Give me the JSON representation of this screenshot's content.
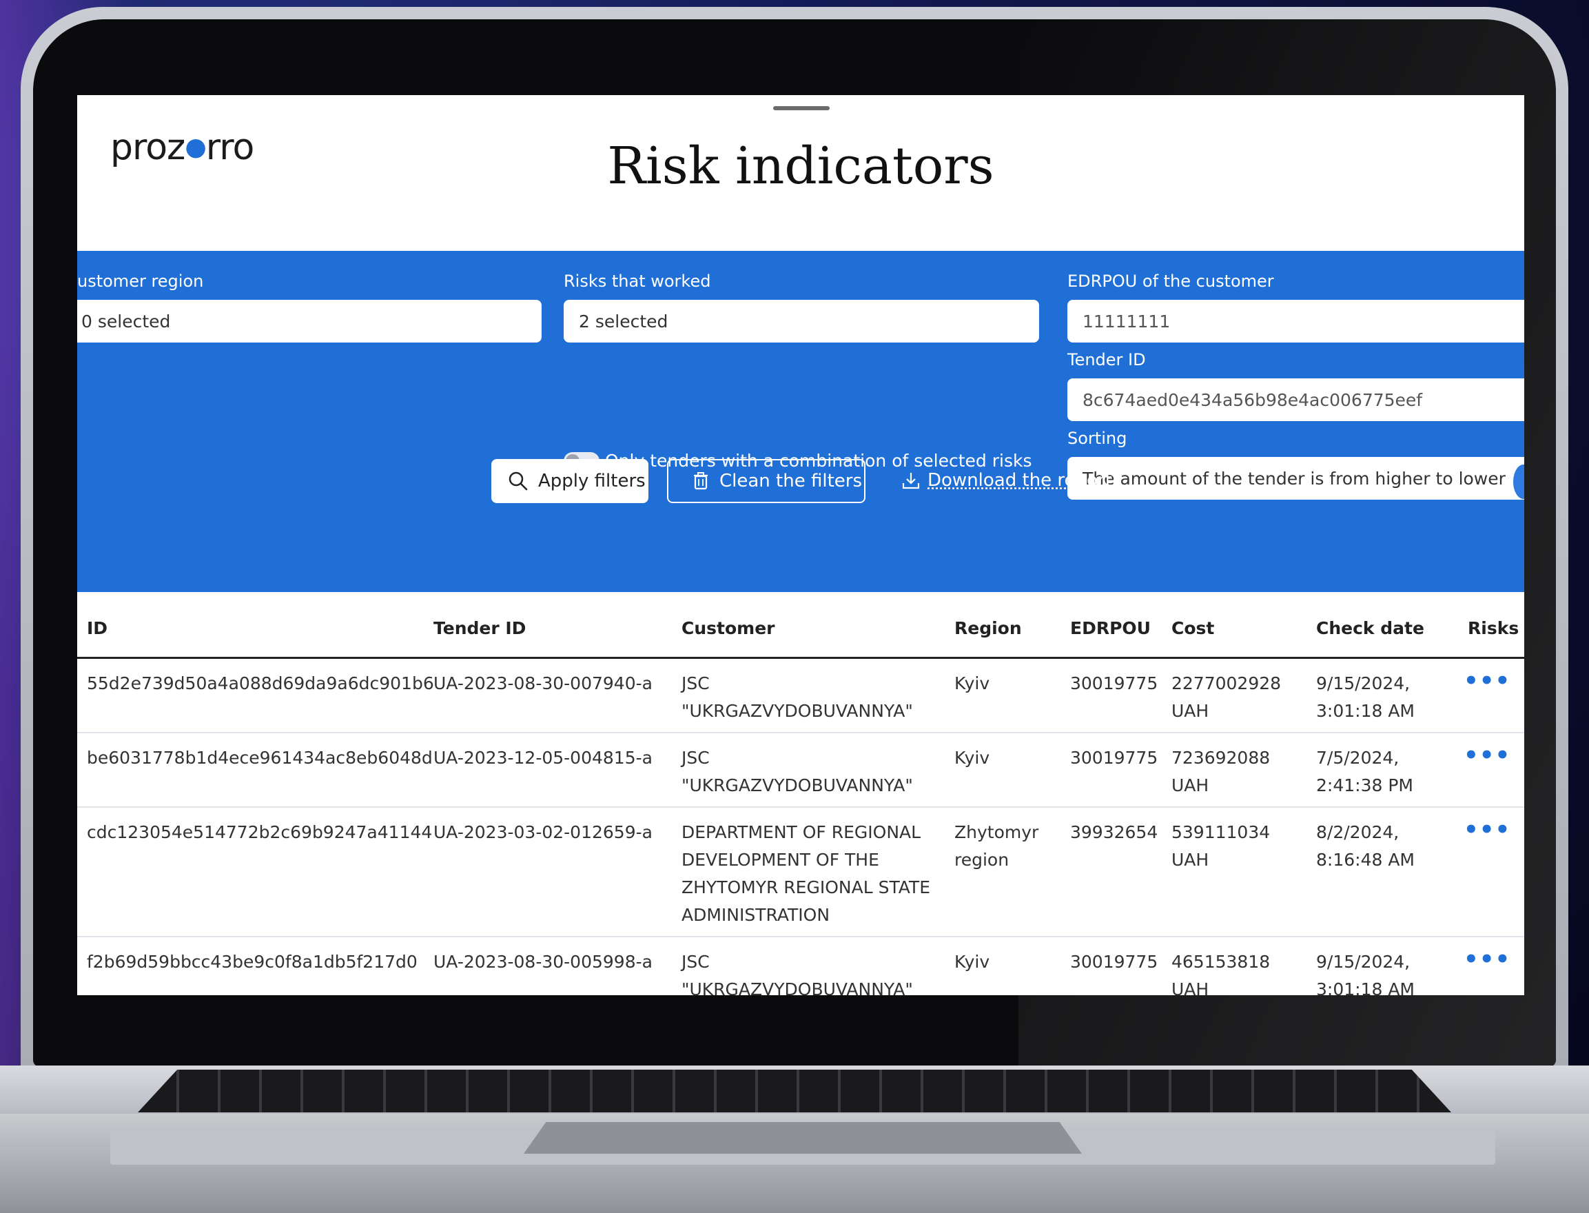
{
  "app": {
    "logo": "prozorro",
    "logo_left": "proz",
    "logo_right": "rro",
    "title": "Risk indicators"
  },
  "filters": {
    "customer_region": {
      "label": "ustomer region",
      "value": "0 selected"
    },
    "risks_worked": {
      "label": "Risks that worked",
      "value": "2 selected"
    },
    "combination_toggle": {
      "label": "Only tenders with a combination of selected risks",
      "on": false
    },
    "edrpou": {
      "label": "EDRPOU of the customer",
      "value": "11111111"
    },
    "tender_id": {
      "label": "Tender ID",
      "value": "8c674aed0e434a56b98e4ac006775eef"
    },
    "sorting": {
      "label": "Sorting",
      "value": "The amount of the tender is from higher to lower"
    },
    "apply_label": "Apply filters",
    "clean_label": "Clean the filters",
    "download_label": "Download the report"
  },
  "table": {
    "headers": {
      "id": "ID",
      "tender_id": "Tender ID",
      "customer": "Customer",
      "region": "Region",
      "edrpou": "EDRPOU",
      "cost": "Cost",
      "check_date": "Check date",
      "risks": "Risks"
    },
    "rows": [
      {
        "id": "55d2e739d50a4a088d69da9a6dc901b6",
        "tender_id": "UA-2023-08-30-007940-a",
        "customer": [
          "JSC",
          "\"UKRGAZVYDOBUVANNYA\""
        ],
        "region": [
          "Kyiv"
        ],
        "edrpou": "30019775",
        "cost": [
          "2277002928",
          "UAH"
        ],
        "check_date": [
          "9/15/2024,",
          "3:01:18 AM"
        ],
        "risks": "•••"
      },
      {
        "id": "be6031778b1d4ece961434ac8eb6048d",
        "tender_id": "UA-2023-12-05-004815-a",
        "customer": [
          "JSC",
          "\"UKRGAZVYDOBUVANNYA\""
        ],
        "region": [
          "Kyiv"
        ],
        "edrpou": "30019775",
        "cost": [
          "723692088",
          "UAH"
        ],
        "check_date": [
          "7/5/2024,",
          "2:41:38 PM"
        ],
        "risks": "•••"
      },
      {
        "id": "cdc123054e514772b2c69b9247a41144",
        "tender_id": "UA-2023-03-02-012659-a",
        "customer": [
          "DEPARTMENT OF REGIONAL",
          "DEVELOPMENT OF THE",
          "ZHYTOMYR REGIONAL STATE",
          "ADMINISTRATION"
        ],
        "region": [
          "Zhytomyr",
          "region"
        ],
        "edrpou": "39932654",
        "cost": [
          "539111034",
          "UAH"
        ],
        "check_date": [
          "8/2/2024,",
          "8:16:48 AM"
        ],
        "risks": "•••"
      },
      {
        "id": "f2b69d59bbcc43be9c0f8a1db5f217d0",
        "tender_id": "UA-2023-08-30-005998-a",
        "customer": [
          "JSC",
          "\"UKRGAZVYDOBUVANNYA\""
        ],
        "region": [
          "Kyiv"
        ],
        "edrpou": "30019775",
        "cost": [
          "465153818",
          "UAH"
        ],
        "check_date": [
          "9/15/2024,",
          "3:01:18 AM"
        ],
        "risks": "•••"
      }
    ]
  },
  "colors": {
    "accent": "#1f6fd6",
    "header_border": "#222222"
  }
}
